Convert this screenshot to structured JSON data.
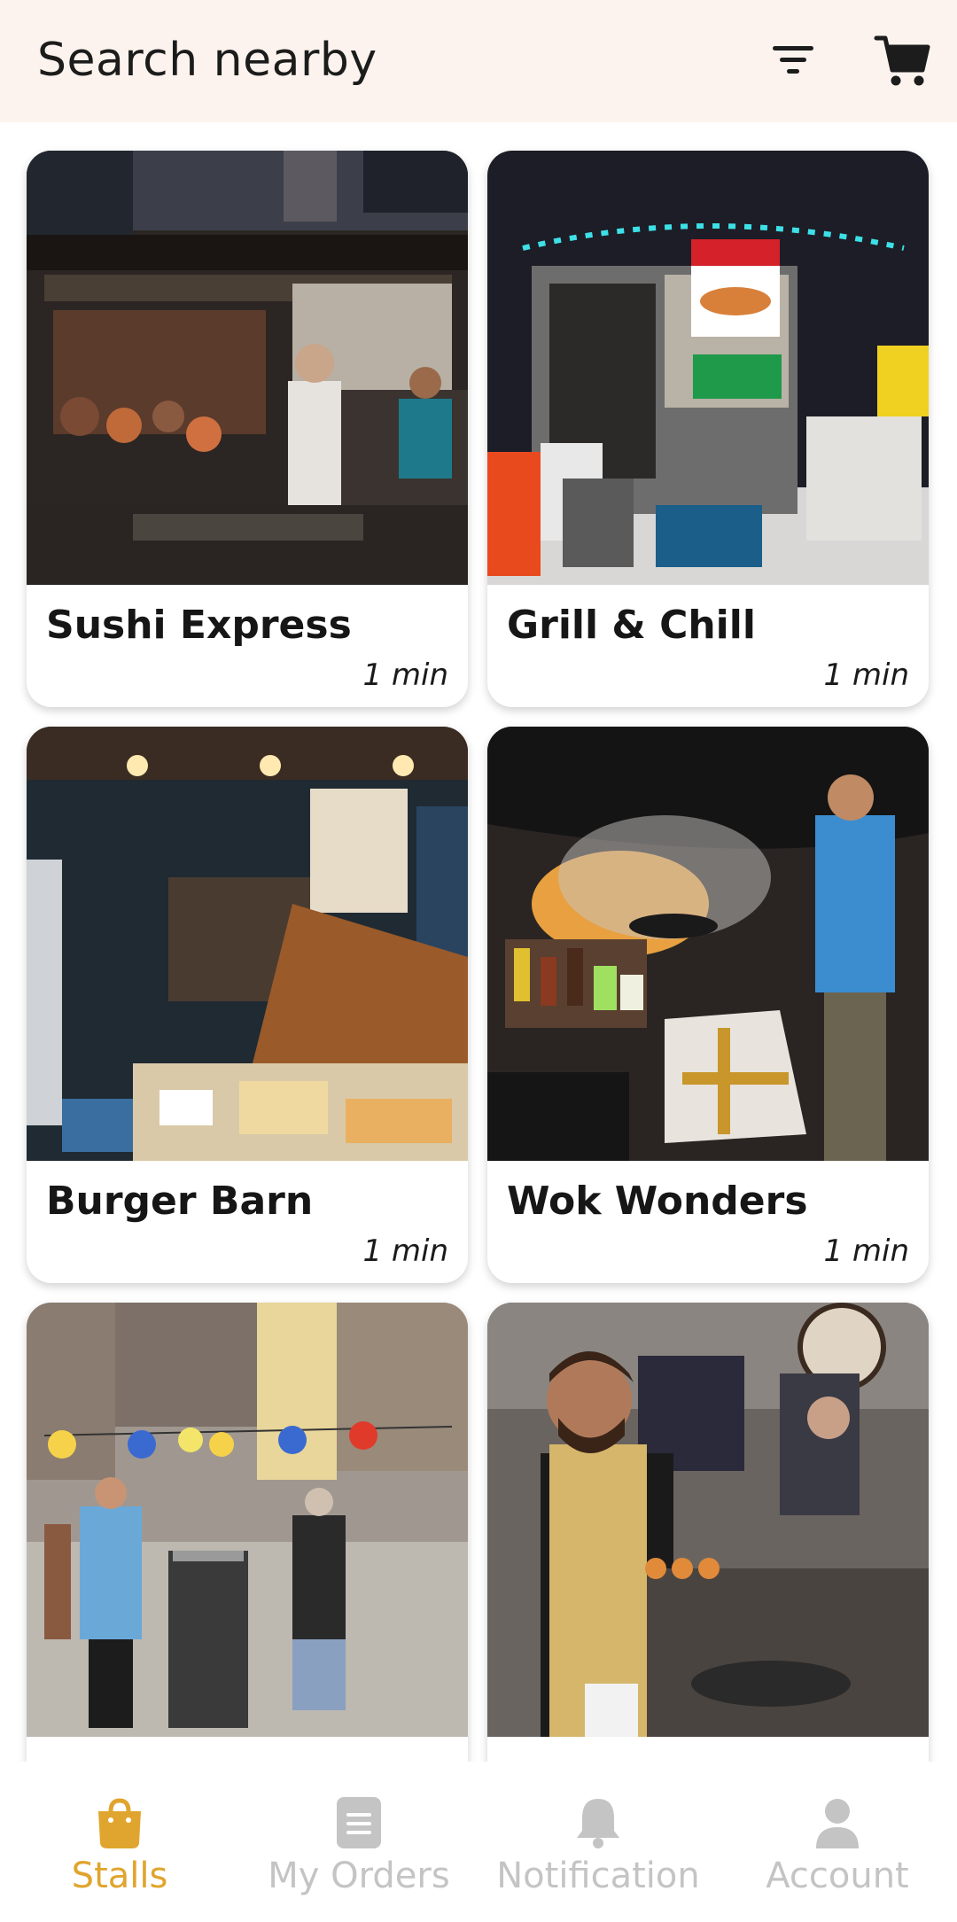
{
  "header": {
    "title": "Search nearby",
    "filter_icon": "filter-icon",
    "cart_icon": "cart-icon"
  },
  "stalls": [
    {
      "name": "Sushi Express",
      "time": "1 min",
      "image": "night food court photo"
    },
    {
      "name": "Grill & Chill",
      "time": "1 min",
      "image": "hot dog cart in snow photo"
    },
    {
      "name": "Burger Barn",
      "time": "1 min",
      "image": "market food stall photo"
    },
    {
      "name": "Wok Wonders",
      "time": "1 min",
      "image": "wok cooking stall photo"
    },
    {
      "name": "",
      "time": "",
      "image": "street market with lanterns photo"
    },
    {
      "name": "",
      "time": "",
      "image": "chef at food stall photo"
    }
  ],
  "bottom_nav": {
    "items": [
      {
        "label": "Stalls",
        "icon": "shopping-bag-icon",
        "active": true
      },
      {
        "label": "My Orders",
        "icon": "orders-icon",
        "active": false
      },
      {
        "label": "Notification",
        "icon": "bell-icon",
        "active": false
      },
      {
        "label": "Account",
        "icon": "user-icon",
        "active": false
      }
    ]
  },
  "colors": {
    "accent": "#e0a52e",
    "inactive": "#c4c4c4",
    "header_bg": "#fdf3ee"
  }
}
